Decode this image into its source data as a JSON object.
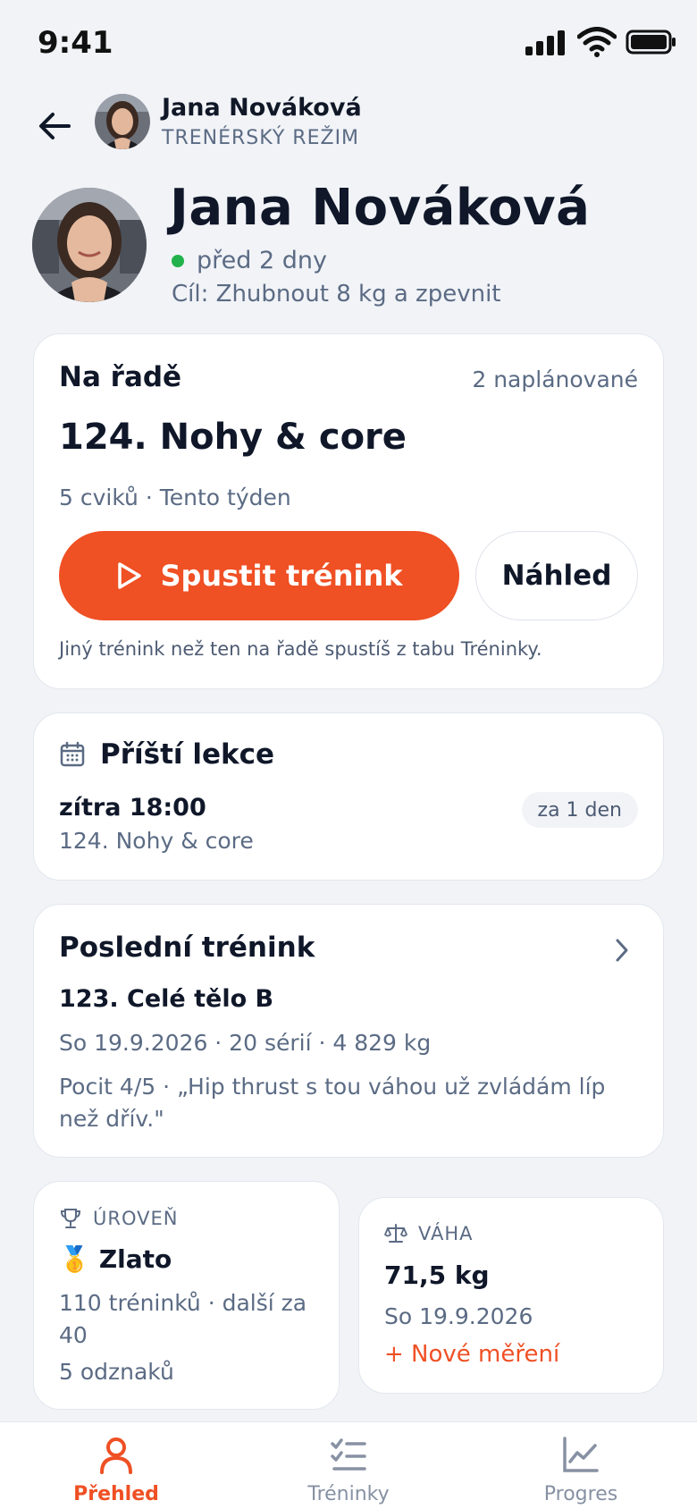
{
  "status_bar": {
    "time": "9:41"
  },
  "header": {
    "name": "Jana Nováková",
    "mode": "TRENÉRSKÝ REŽIM"
  },
  "profile": {
    "name": "Jana Nováková",
    "last_seen": "před 2 dny",
    "goal": "Cíl: Zhubnout 8 kg a zpevnit"
  },
  "queue": {
    "title": "Na řadě",
    "count": "2 naplánované",
    "workout": "124. Nohy & core",
    "meta": "5 cviků · Tento týden",
    "start_label": "Spustit trénink",
    "preview_label": "Náhled",
    "hint": "Jiný trénink než ten na řadě spustíš z tabu Tréninky."
  },
  "next_lesson": {
    "title": "Příští lekce",
    "time": "zítra 18:00",
    "workout": "124. Nohy & core",
    "badge": "za 1 den"
  },
  "last_workout": {
    "title": "Poslední trénink",
    "workout": "123. Celé tělo B",
    "meta": "So 19.9.2026 · 20 sérií · 4 829 kg",
    "note": "Pocit 4/5 · „Hip thrust s tou váhou už zvládám líp než dřív.\""
  },
  "level": {
    "label": "ÚROVEŇ",
    "medal": "🥇",
    "value": "Zlato",
    "progress": "110 tréninků · další za 40",
    "badges": "5 odznaků"
  },
  "weight": {
    "label": "VÁHA",
    "value": "71,5 kg",
    "date": "So 19.9.2026",
    "new_measurement": "+ Nové měření"
  },
  "tabs": [
    {
      "label": "Přehled",
      "icon": "person-icon",
      "active": true
    },
    {
      "label": "Tréninky",
      "icon": "checklist-icon",
      "active": false
    },
    {
      "label": "Progres",
      "icon": "chart-icon",
      "active": false
    }
  ],
  "colors": {
    "accent": "#ef5024",
    "online": "#22b24c",
    "background": "#f1f3f7"
  }
}
